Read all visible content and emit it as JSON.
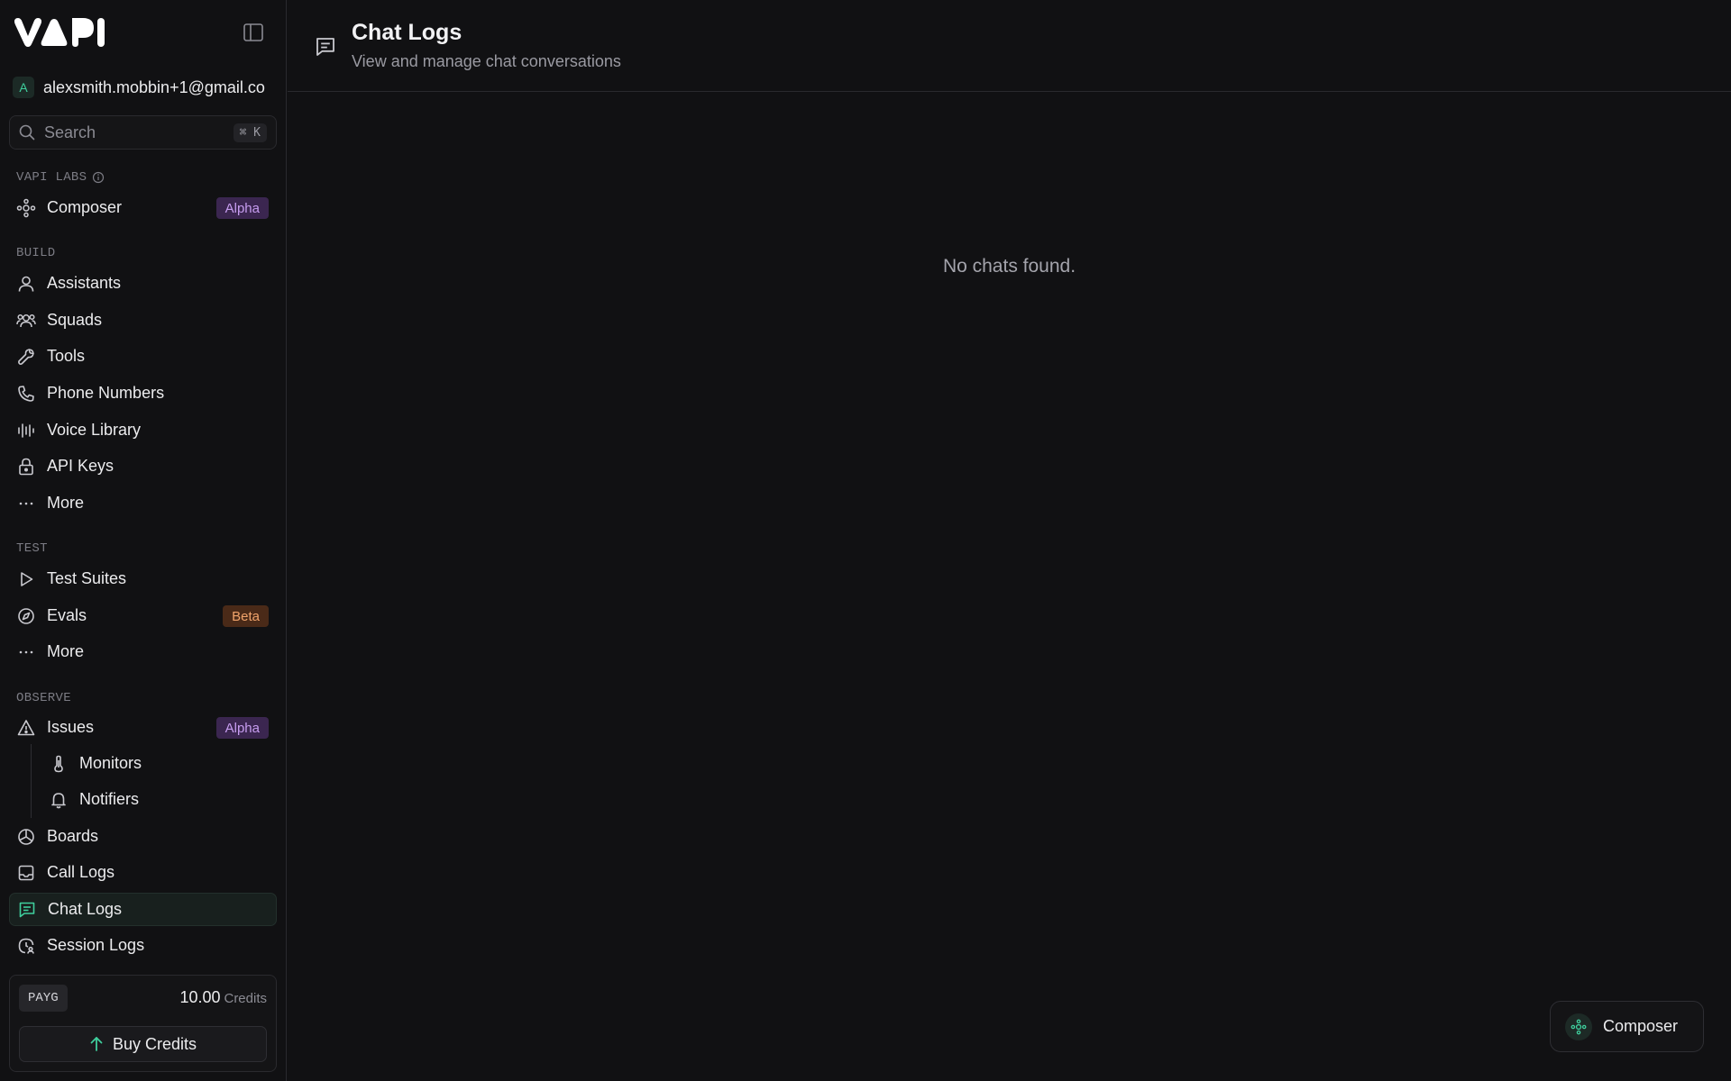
{
  "brand": {
    "logo_text": "VAPI"
  },
  "account": {
    "initial": "A",
    "email": "alexsmith.mobbin+1@gmail.co"
  },
  "search": {
    "placeholder": "Search",
    "shortcut": "⌘ K"
  },
  "sidebar": {
    "sections": {
      "labs": "VAPI LABS",
      "build": "BUILD",
      "test": "TEST",
      "observe": "OBSERVE"
    },
    "labs_items": [
      {
        "label": "Composer",
        "icon": "composer-icon",
        "badge": "Alpha"
      }
    ],
    "build_items": [
      {
        "label": "Assistants",
        "icon": "user-icon"
      },
      {
        "label": "Squads",
        "icon": "users-icon"
      },
      {
        "label": "Tools",
        "icon": "wrench-icon"
      },
      {
        "label": "Phone Numbers",
        "icon": "phone-icon"
      },
      {
        "label": "Voice Library",
        "icon": "audio-wave-icon"
      },
      {
        "label": "API Keys",
        "icon": "lock-icon"
      },
      {
        "label": "More",
        "icon": "ellipsis-icon"
      }
    ],
    "test_items": [
      {
        "label": "Test Suites",
        "icon": "play-icon"
      },
      {
        "label": "Evals",
        "icon": "compass-icon",
        "badge": "Beta"
      },
      {
        "label": "More",
        "icon": "ellipsis-icon"
      }
    ],
    "observe_items": [
      {
        "label": "Issues",
        "icon": "warning-icon",
        "badge": "Alpha"
      },
      {
        "label": "Monitors",
        "icon": "thermometer-icon"
      },
      {
        "label": "Notifiers",
        "icon": "bell-icon"
      },
      {
        "label": "Boards",
        "icon": "pie-chart-icon"
      },
      {
        "label": "Call Logs",
        "icon": "inbox-icon"
      },
      {
        "label": "Chat Logs",
        "icon": "message-square-icon",
        "active": true
      },
      {
        "label": "Session Logs",
        "icon": "clock-user-icon"
      }
    ]
  },
  "credits": {
    "plan": "PAYG",
    "amount": "10.00",
    "unit": "Credits",
    "buy_label": "Buy Credits"
  },
  "page": {
    "title": "Chat Logs",
    "subtitle": "View and manage chat conversations",
    "empty_message": "No chats found."
  },
  "fab": {
    "label": "Composer"
  },
  "colors": {
    "background": "#111113",
    "accent": "#3fcf9d",
    "alpha_badge": "#c79df0",
    "beta_badge": "#f0a36b"
  }
}
